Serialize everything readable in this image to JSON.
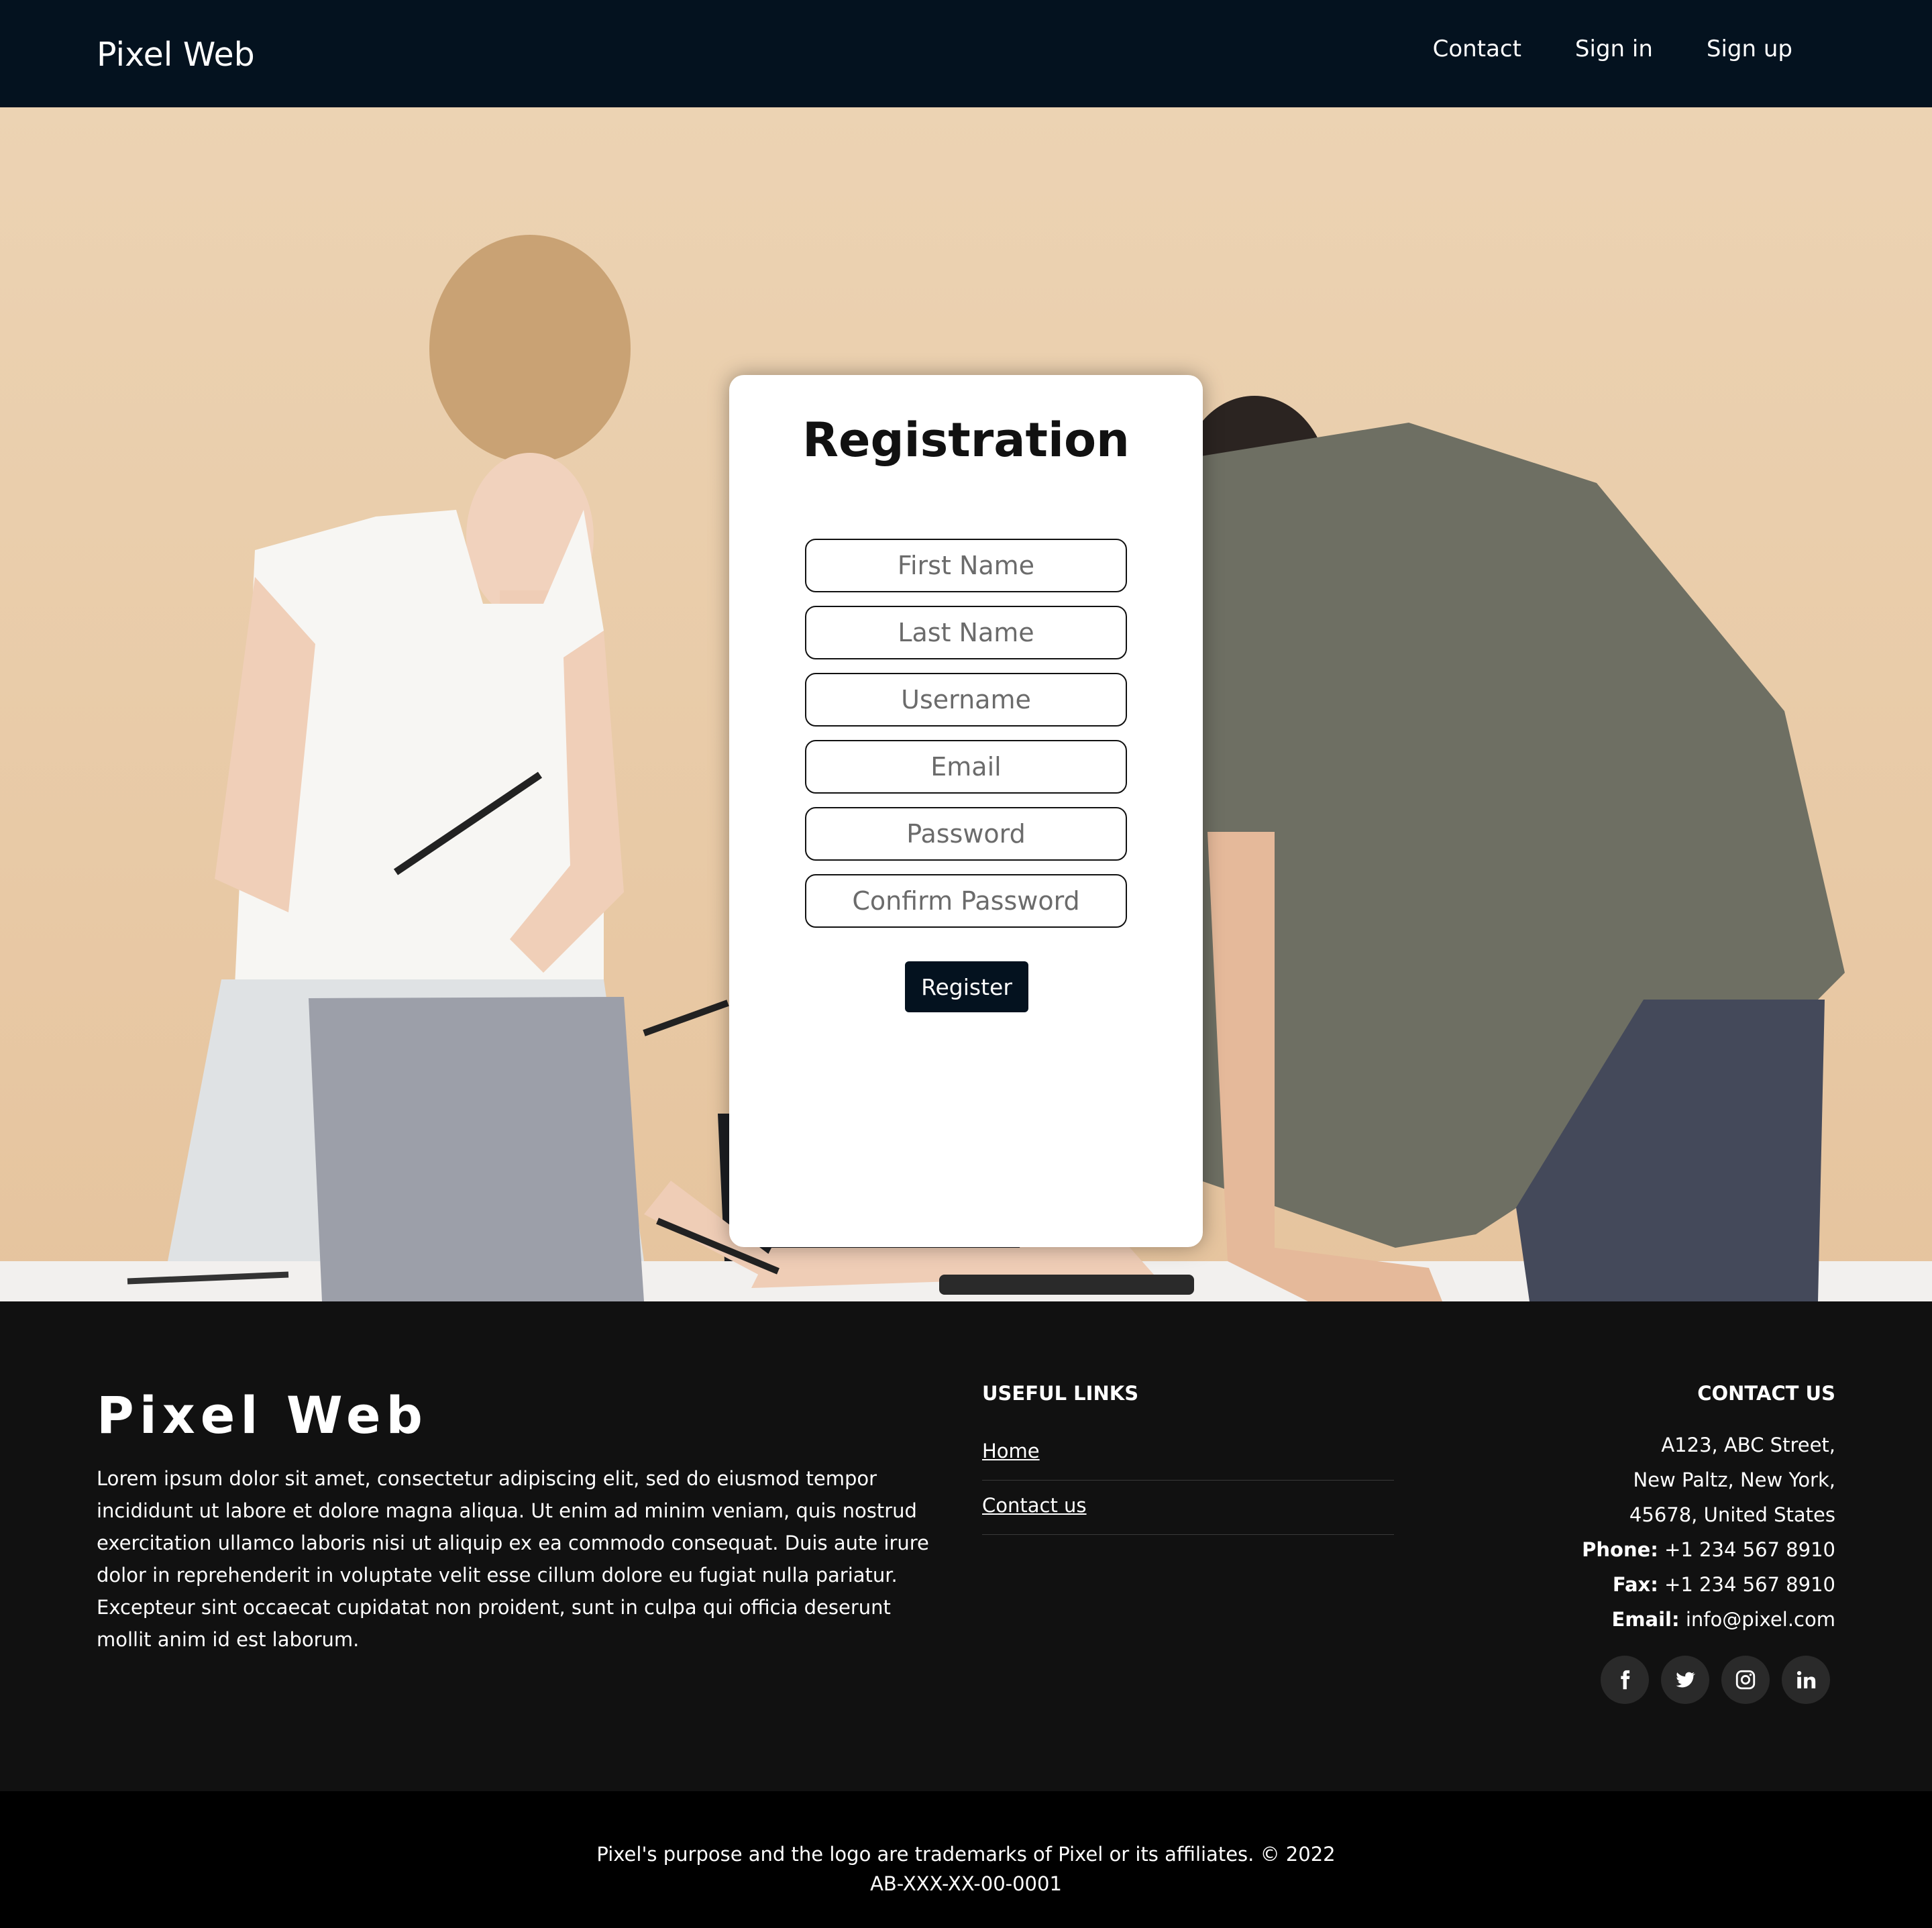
{
  "navbar": {
    "brand": "Pixel Web",
    "links": [
      "Contact",
      "Sign in",
      "Sign up"
    ]
  },
  "registration": {
    "title": "Registration",
    "fields": {
      "first_name": "First Name",
      "last_name": "Last Name",
      "username": "Username",
      "email": "Email",
      "password": "Password",
      "confirm_password": "Confirm Password"
    },
    "submit_label": "Register"
  },
  "footer": {
    "brand": "Pixel Web",
    "description": "Lorem ipsum dolor sit amet, consectetur adipiscing elit, sed do eiusmod tempor incididunt ut labore et dolore magna aliqua. Ut enim ad minim veniam, quis nostrud exercitation ullamco laboris nisi ut aliquip ex ea commodo consequat. Duis aute irure dolor in reprehenderit in voluptate velit esse cillum dolore eu fugiat nulla pariatur. Excepteur sint occaecat cupidatat non proident, sunt in culpa qui officia deserunt mollit anim id est laborum.",
    "useful_links": {
      "heading": "USEFUL LINKS",
      "items": [
        "Home",
        "Contact us"
      ]
    },
    "contact": {
      "heading": "CONTACT US",
      "address_line1": "A123, ABC Street,",
      "address_line2": "New Paltz, New York,",
      "address_line3": "45678, United States",
      "phone_label": "Phone:",
      "phone": "+1 234 567 8910",
      "fax_label": "Fax:",
      "fax": "+1 234 567 8910",
      "email_label": "Email:",
      "email": "info@pixel.com"
    },
    "socials": [
      "facebook-icon",
      "twitter-icon",
      "instagram-icon",
      "linkedin-icon"
    ]
  },
  "bottom_bar": {
    "line1": "Pixel's purpose and the logo are trademarks of Pixel or its affiliates. © 2022",
    "line2": "AB-XXX-XX-00-0001"
  },
  "colors": {
    "navbar_bg": "#04121f",
    "hero_bg": "#ecd3b3",
    "footer_bg": "#111111",
    "bottom_bg": "#000000",
    "button_bg": "#04121f"
  }
}
